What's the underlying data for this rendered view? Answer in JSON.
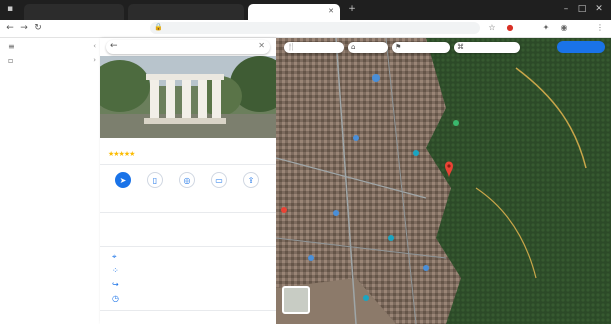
{
  "browser": {
    "tabs": [
      {
        "label": "",
        "active": false
      },
      {
        "label": "",
        "active": false
      },
      {
        "label": "",
        "active": true
      }
    ],
    "url": ""
  },
  "rail": {
    "items": [
      {
        "label": "",
        "icon": "menu-icon"
      },
      {
        "label": "",
        "icon": "place-icon"
      }
    ]
  },
  "panel": {
    "search_value": "",
    "place_title": "",
    "place_subtitle": "",
    "rating_stars": "★★★★★",
    "review_count": "",
    "actions": [
      {
        "label": "",
        "icon": "directions-icon",
        "primary": true
      },
      {
        "label": "",
        "icon": "save-icon",
        "primary": false
      },
      {
        "label": "",
        "icon": "nearby-icon",
        "primary": false
      },
      {
        "label": "",
        "icon": "send-to-phone-icon",
        "primary": false
      },
      {
        "label": "",
        "icon": "share-icon",
        "primary": false
      }
    ],
    "description": [
      "",
      "",
      ""
    ],
    "info_rows": [
      {
        "icon": "location-pin-icon",
        "text": ""
      },
      {
        "icon": "plus-code-icon",
        "text": ""
      },
      {
        "icon": "send-to-phone-icon",
        "text": ""
      },
      {
        "icon": "history-icon",
        "text": ""
      }
    ],
    "bottom_link": ""
  },
  "map": {
    "category_chips": [
      {
        "label": "",
        "icon": "restaurant-icon"
      },
      {
        "label": "",
        "icon": "hotel-icon"
      },
      {
        "label": "",
        "icon": "attraction-icon"
      },
      {
        "label": "",
        "icon": "museum-icon"
      }
    ],
    "signin_label": "",
    "layers_label": ""
  },
  "colors": {
    "accent": "#1a73e8",
    "marker_red": "#ea4335",
    "park_green": "#2e5e2a",
    "urban": "#8a7566"
  }
}
